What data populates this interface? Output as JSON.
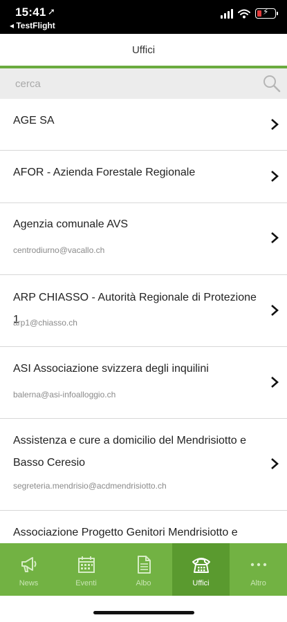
{
  "status": {
    "time": "15:41",
    "location_glyph": "➚",
    "back_label": "◂ TestFlight"
  },
  "colors": {
    "accent": "#6aab3f",
    "tabbar": "#72b243",
    "tab_active": "#5a9a2f"
  },
  "header": {
    "title": "Uffici"
  },
  "search": {
    "placeholder": "cerca",
    "value": ""
  },
  "offices": [
    {
      "name": "AGE SA",
      "email": ""
    },
    {
      "name": "AFOR - Azienda Forestale Regionale",
      "email": ""
    },
    {
      "name": "Agenzia comunale AVS",
      "email": "centrodiurno@vacallo.ch"
    },
    {
      "name": "ARP CHIASSO - Autorità Regionale di Protezione 1",
      "email": "arp1@chiasso.ch"
    },
    {
      "name": "ASI Associazione svizzera degli inquilini",
      "email": "balerna@asi-infoalloggio.ch"
    },
    {
      "name": "Assistenza e cure a domicilio del Mendrisiotto e Basso Ceresio",
      "email": "segreteria.mendrisio@acdmendrisiotto.ch"
    },
    {
      "name": "Associazione Progetto Genitori Mendrisiotto e",
      "email": ""
    }
  ],
  "tabs": [
    {
      "label": "News",
      "icon": "megaphone-icon",
      "active": false
    },
    {
      "label": "Eventi",
      "icon": "calendar-icon",
      "active": false
    },
    {
      "label": "Albo",
      "icon": "document-icon",
      "active": false
    },
    {
      "label": "Uffici",
      "icon": "telephone-icon",
      "active": true
    },
    {
      "label": "Altro",
      "icon": "more-icon",
      "active": false
    }
  ]
}
